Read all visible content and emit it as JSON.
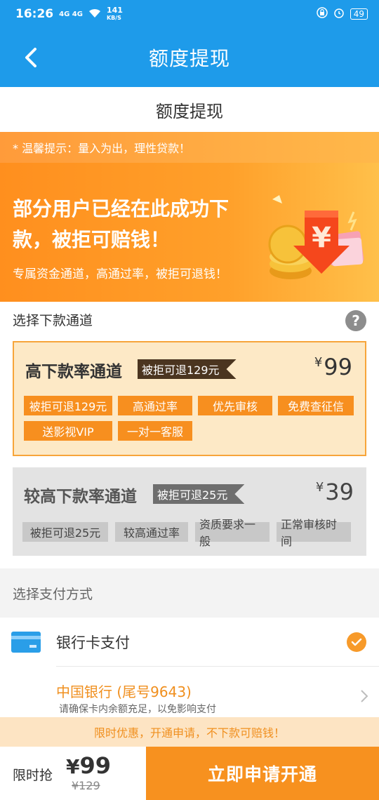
{
  "status_bar": {
    "time": "16:26",
    "signal": "4G 4G",
    "net_speed": "141",
    "net_unit": "KB/S",
    "battery": "49"
  },
  "nav": {
    "title": "额度提现"
  },
  "page": {
    "subtitle": "额度提现"
  },
  "tip": {
    "text": "* 温馨提示：量入为出，理性贷款！"
  },
  "banner": {
    "headline": "部分用户已经在此成功下款，被拒可赔钱！",
    "subtext": "专属资金通道，高通过率，被拒可退钱！",
    "currency_symbol": "¥"
  },
  "channel_section": {
    "label": "选择下款通道",
    "help": "?"
  },
  "channels": [
    {
      "title": "高下款率通道",
      "badge": "被拒可退129元",
      "currency": "¥",
      "price": "99",
      "tags": [
        "被拒可退129元",
        "高通过率",
        "优先审核",
        "免费查征信",
        "送影视VIP",
        "一对一客服"
      ]
    },
    {
      "title": "较高下款率通道",
      "badge": "被拒可退25元",
      "currency": "¥",
      "price": "39",
      "tags": [
        "被拒可退25元",
        "较高通过率",
        "资质要求一般",
        "正常审核时间"
      ]
    }
  ],
  "payment": {
    "label": "选择支付方式",
    "method": "银行卡支付",
    "bank_name": "中国银行 (尾号9643)",
    "bank_note": "请确保卡内余额充足，以免影响支付"
  },
  "promo": {
    "text": "限时优惠，开通申请，不下款可赔钱！"
  },
  "bottom": {
    "label": "限时抢",
    "currency": "¥",
    "price": "99",
    "original_price": "¥129",
    "apply_label": "立即申请开通"
  },
  "colors": {
    "brand_blue": "#1e9bea",
    "accent_orange": "#f7911f"
  }
}
